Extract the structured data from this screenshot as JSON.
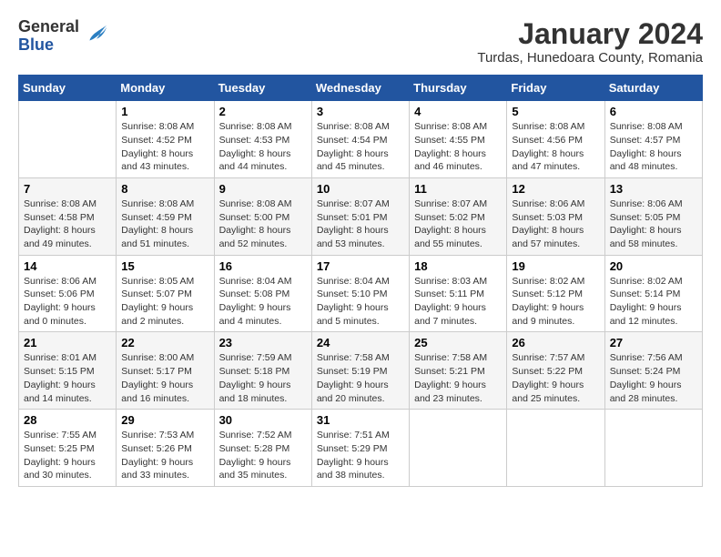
{
  "logo": {
    "general": "General",
    "blue": "Blue"
  },
  "title": "January 2024",
  "subtitle": "Turdas, Hunedoara County, Romania",
  "days_of_week": [
    "Sunday",
    "Monday",
    "Tuesday",
    "Wednesday",
    "Thursday",
    "Friday",
    "Saturday"
  ],
  "weeks": [
    [
      {
        "day": "",
        "info": ""
      },
      {
        "day": "1",
        "info": "Sunrise: 8:08 AM\nSunset: 4:52 PM\nDaylight: 8 hours\nand 43 minutes."
      },
      {
        "day": "2",
        "info": "Sunrise: 8:08 AM\nSunset: 4:53 PM\nDaylight: 8 hours\nand 44 minutes."
      },
      {
        "day": "3",
        "info": "Sunrise: 8:08 AM\nSunset: 4:54 PM\nDaylight: 8 hours\nand 45 minutes."
      },
      {
        "day": "4",
        "info": "Sunrise: 8:08 AM\nSunset: 4:55 PM\nDaylight: 8 hours\nand 46 minutes."
      },
      {
        "day": "5",
        "info": "Sunrise: 8:08 AM\nSunset: 4:56 PM\nDaylight: 8 hours\nand 47 minutes."
      },
      {
        "day": "6",
        "info": "Sunrise: 8:08 AM\nSunset: 4:57 PM\nDaylight: 8 hours\nand 48 minutes."
      }
    ],
    [
      {
        "day": "7",
        "info": "Sunrise: 8:08 AM\nSunset: 4:58 PM\nDaylight: 8 hours\nand 49 minutes."
      },
      {
        "day": "8",
        "info": "Sunrise: 8:08 AM\nSunset: 4:59 PM\nDaylight: 8 hours\nand 51 minutes."
      },
      {
        "day": "9",
        "info": "Sunrise: 8:08 AM\nSunset: 5:00 PM\nDaylight: 8 hours\nand 52 minutes."
      },
      {
        "day": "10",
        "info": "Sunrise: 8:07 AM\nSunset: 5:01 PM\nDaylight: 8 hours\nand 53 minutes."
      },
      {
        "day": "11",
        "info": "Sunrise: 8:07 AM\nSunset: 5:02 PM\nDaylight: 8 hours\nand 55 minutes."
      },
      {
        "day": "12",
        "info": "Sunrise: 8:06 AM\nSunset: 5:03 PM\nDaylight: 8 hours\nand 57 minutes."
      },
      {
        "day": "13",
        "info": "Sunrise: 8:06 AM\nSunset: 5:05 PM\nDaylight: 8 hours\nand 58 minutes."
      }
    ],
    [
      {
        "day": "14",
        "info": "Sunrise: 8:06 AM\nSunset: 5:06 PM\nDaylight: 9 hours\nand 0 minutes."
      },
      {
        "day": "15",
        "info": "Sunrise: 8:05 AM\nSunset: 5:07 PM\nDaylight: 9 hours\nand 2 minutes."
      },
      {
        "day": "16",
        "info": "Sunrise: 8:04 AM\nSunset: 5:08 PM\nDaylight: 9 hours\nand 4 minutes."
      },
      {
        "day": "17",
        "info": "Sunrise: 8:04 AM\nSunset: 5:10 PM\nDaylight: 9 hours\nand 5 minutes."
      },
      {
        "day": "18",
        "info": "Sunrise: 8:03 AM\nSunset: 5:11 PM\nDaylight: 9 hours\nand 7 minutes."
      },
      {
        "day": "19",
        "info": "Sunrise: 8:02 AM\nSunset: 5:12 PM\nDaylight: 9 hours\nand 9 minutes."
      },
      {
        "day": "20",
        "info": "Sunrise: 8:02 AM\nSunset: 5:14 PM\nDaylight: 9 hours\nand 12 minutes."
      }
    ],
    [
      {
        "day": "21",
        "info": "Sunrise: 8:01 AM\nSunset: 5:15 PM\nDaylight: 9 hours\nand 14 minutes."
      },
      {
        "day": "22",
        "info": "Sunrise: 8:00 AM\nSunset: 5:17 PM\nDaylight: 9 hours\nand 16 minutes."
      },
      {
        "day": "23",
        "info": "Sunrise: 7:59 AM\nSunset: 5:18 PM\nDaylight: 9 hours\nand 18 minutes."
      },
      {
        "day": "24",
        "info": "Sunrise: 7:58 AM\nSunset: 5:19 PM\nDaylight: 9 hours\nand 20 minutes."
      },
      {
        "day": "25",
        "info": "Sunrise: 7:58 AM\nSunset: 5:21 PM\nDaylight: 9 hours\nand 23 minutes."
      },
      {
        "day": "26",
        "info": "Sunrise: 7:57 AM\nSunset: 5:22 PM\nDaylight: 9 hours\nand 25 minutes."
      },
      {
        "day": "27",
        "info": "Sunrise: 7:56 AM\nSunset: 5:24 PM\nDaylight: 9 hours\nand 28 minutes."
      }
    ],
    [
      {
        "day": "28",
        "info": "Sunrise: 7:55 AM\nSunset: 5:25 PM\nDaylight: 9 hours\nand 30 minutes."
      },
      {
        "day": "29",
        "info": "Sunrise: 7:53 AM\nSunset: 5:26 PM\nDaylight: 9 hours\nand 33 minutes."
      },
      {
        "day": "30",
        "info": "Sunrise: 7:52 AM\nSunset: 5:28 PM\nDaylight: 9 hours\nand 35 minutes."
      },
      {
        "day": "31",
        "info": "Sunrise: 7:51 AM\nSunset: 5:29 PM\nDaylight: 9 hours\nand 38 minutes."
      },
      {
        "day": "",
        "info": ""
      },
      {
        "day": "",
        "info": ""
      },
      {
        "day": "",
        "info": ""
      }
    ]
  ]
}
